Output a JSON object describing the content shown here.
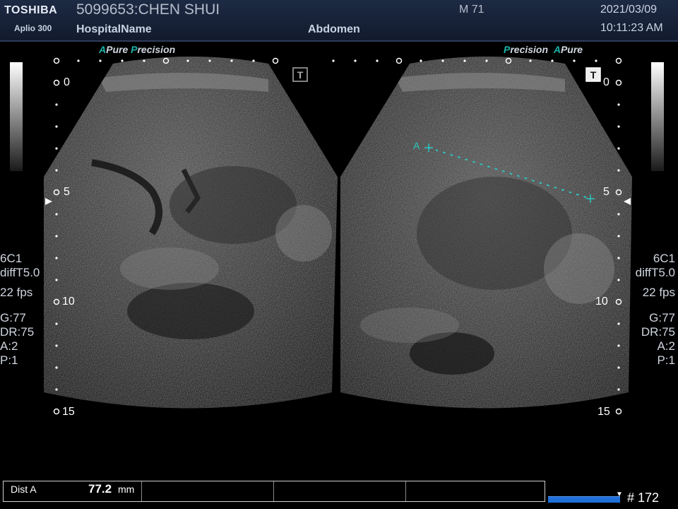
{
  "header": {
    "brand": "TOSHIBA",
    "model": "Aplio 300",
    "patient": "5099653:CHEN SHUI",
    "hospital": "HospitalName",
    "sex_age": "M 71",
    "exam": "Abdomen",
    "date": "2021/03/09",
    "time": "10:11:23 AM"
  },
  "logos": {
    "left": {
      "a": "A",
      "pure": "Pure",
      "p": "P",
      "recision": "recision"
    },
    "right": {
      "p": "P",
      "recision": "recision",
      "a": "A",
      "pure": "Pure"
    }
  },
  "depth_labels": {
    "left": [
      "0",
      "5",
      "10",
      "15"
    ],
    "right": [
      "0",
      "5",
      "10",
      "15"
    ]
  },
  "params_left": {
    "probe": "6C1",
    "mode": "diffT5.0",
    "fps": "22 fps",
    "gain": "G:77",
    "dr": "DR:75",
    "a": "A:2",
    "p": "P:1"
  },
  "params_right": {
    "probe": "6C1",
    "mode": "diffT5.0",
    "fps": "22 fps",
    "gain": "G:77",
    "dr": "DR:75",
    "a": "A:2",
    "p": "P:1"
  },
  "measurement": {
    "caliper_label": "A",
    "label": "Dist A",
    "value": "77.2",
    "unit": "mm"
  },
  "cine": {
    "frame": "# 172"
  },
  "colors": {
    "caliper": "#2ec4c0",
    "accent": "#1bb3a8",
    "cine_bar": "#1f6fd8"
  }
}
